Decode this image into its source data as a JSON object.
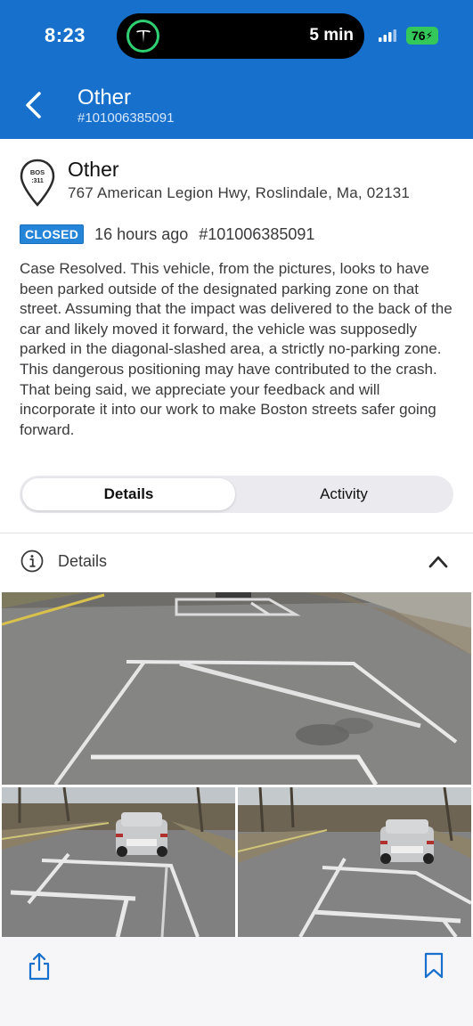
{
  "status_bar": {
    "time": "8:23",
    "activity_text": "5 min",
    "battery": "76"
  },
  "nav": {
    "title": "Other",
    "subtitle": "#101006385091"
  },
  "case": {
    "pin_label_line1": "BOS",
    "pin_label_line2": ":311",
    "title": "Other",
    "address": "767 American Legion Hwy, Roslindale, Ma, 02131",
    "status": "CLOSED",
    "time_ago": "16 hours ago",
    "case_number": "#101006385091",
    "description": "Case Resolved. This vehicle, from the pictures, looks to have been parked outside of the designated parking zone on that street. Assuming that the impact was delivered to the back of the car and likely moved it forward, the vehicle was supposedly parked in the diagonal-slashed area, a strictly no-parking zone. This dangerous positioning may have contributed to the crash. That being said, we appreciate your feedback and will incorporate it into our work to make Boston streets safer going forward."
  },
  "tabs": [
    {
      "label": "Details",
      "active": true
    },
    {
      "label": "Activity",
      "active": false
    }
  ],
  "section": {
    "label": "Details",
    "icon": "info-icon",
    "toggle_icon": "chevron-up-icon"
  },
  "toolbar": {
    "left_icon": "share-icon",
    "right_icon": "bookmark-icon"
  },
  "colors": {
    "brand_blue": "#1670cc",
    "badge_blue": "#2485d8",
    "tesla_green": "#2ed072",
    "battery_green": "#34c759"
  }
}
